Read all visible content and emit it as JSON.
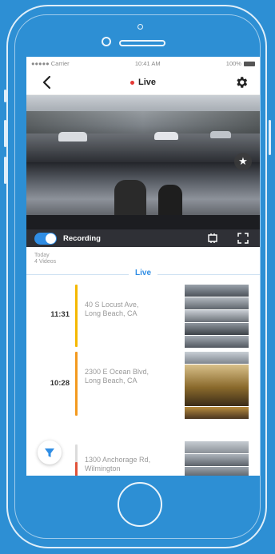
{
  "status_bar": {
    "carrier": "●●●●● Carrier",
    "time": "10:41 AM",
    "battery": "100%"
  },
  "header": {
    "title": "Live",
    "back_icon": "chevron-left-icon",
    "settings_icon": "gear-icon"
  },
  "video": {
    "favorite_icon": "star-icon"
  },
  "recording_bar": {
    "label": "Recording",
    "toggle_on": true,
    "crop_icon": "crop-icon",
    "fullscreen_icon": "expand-icon"
  },
  "day": {
    "label": "Today",
    "count": "4 Videos"
  },
  "live_label": "Live",
  "entries": [
    {
      "time": "11:31",
      "line1": "40 S Locust Ave,",
      "line2": "Long Beach, CA",
      "color": "#f5b800"
    },
    {
      "time": "10:28",
      "line1": "2300 E Ocean Blvd,",
      "line2": "Long Beach, CA",
      "color": "#f39a1f"
    },
    {
      "time": "",
      "line1": "1300 Anchorage Rd,",
      "line2": "Wilmington",
      "color": "#e0533a"
    }
  ],
  "filter_icon": "funnel-icon",
  "colors": {
    "accent": "#2f8de4",
    "recording_dot": "#e53935",
    "background": "#2d8fd4"
  }
}
